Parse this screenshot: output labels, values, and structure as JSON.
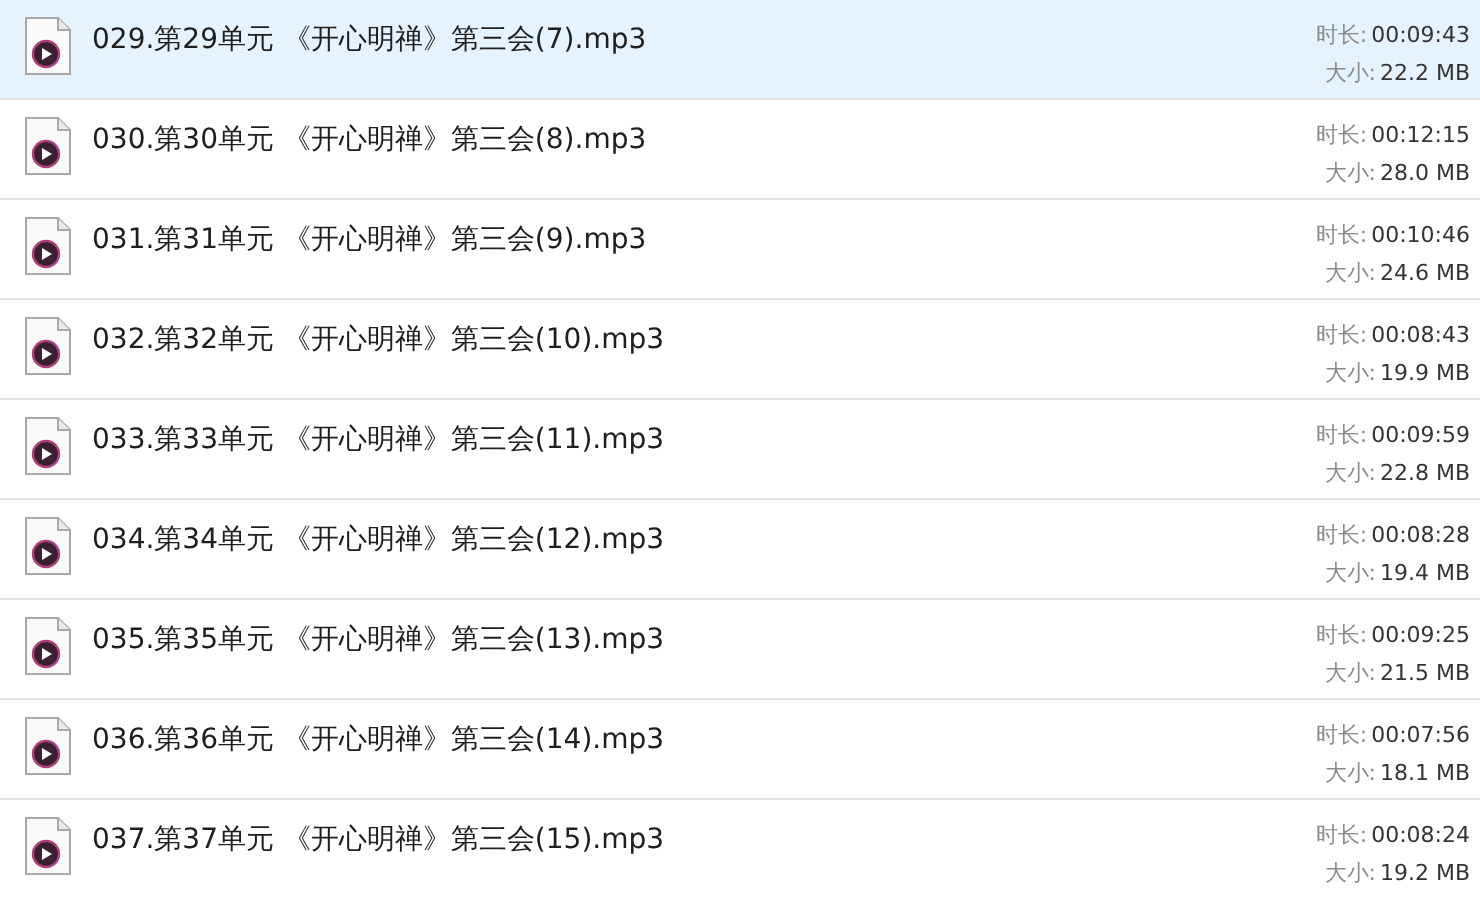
{
  "files": [
    {
      "name": "029.第29单元 《开心明禅》第三会(7).mp3",
      "duration_label": "时长:",
      "duration": "00:09:43",
      "size_label": "大小:",
      "size": "22.2 MB",
      "selected": true
    },
    {
      "name": "030.第30单元 《开心明禅》第三会(8).mp3",
      "duration_label": "时长:",
      "duration": "00:12:15",
      "size_label": "大小:",
      "size": "28.0 MB",
      "selected": false
    },
    {
      "name": "031.第31单元 《开心明禅》第三会(9).mp3",
      "duration_label": "时长:",
      "duration": "00:10:46",
      "size_label": "大小:",
      "size": "24.6 MB",
      "selected": false
    },
    {
      "name": "032.第32单元 《开心明禅》第三会(10).mp3",
      "duration_label": "时长:",
      "duration": "00:08:43",
      "size_label": "大小:",
      "size": "19.9 MB",
      "selected": false
    },
    {
      "name": "033.第33单元 《开心明禅》第三会(11).mp3",
      "duration_label": "时长:",
      "duration": "00:09:59",
      "size_label": "大小:",
      "size": "22.8 MB",
      "selected": false
    },
    {
      "name": "034.第34单元 《开心明禅》第三会(12).mp3",
      "duration_label": "时长:",
      "duration": "00:08:28",
      "size_label": "大小:",
      "size": "19.4 MB",
      "selected": false
    },
    {
      "name": "035.第35单元 《开心明禅》第三会(13).mp3",
      "duration_label": "时长:",
      "duration": "00:09:25",
      "size_label": "大小:",
      "size": "21.5 MB",
      "selected": false
    },
    {
      "name": "036.第36单元 《开心明禅》第三会(14).mp3",
      "duration_label": "时长:",
      "duration": "00:07:56",
      "size_label": "大小:",
      "size": "18.1 MB",
      "selected": false
    },
    {
      "name": "037.第37单元 《开心明禅》第三会(15).mp3",
      "duration_label": "时长:",
      "duration": "00:08:24",
      "size_label": "大小:",
      "size": "19.2 MB",
      "selected": false
    }
  ]
}
